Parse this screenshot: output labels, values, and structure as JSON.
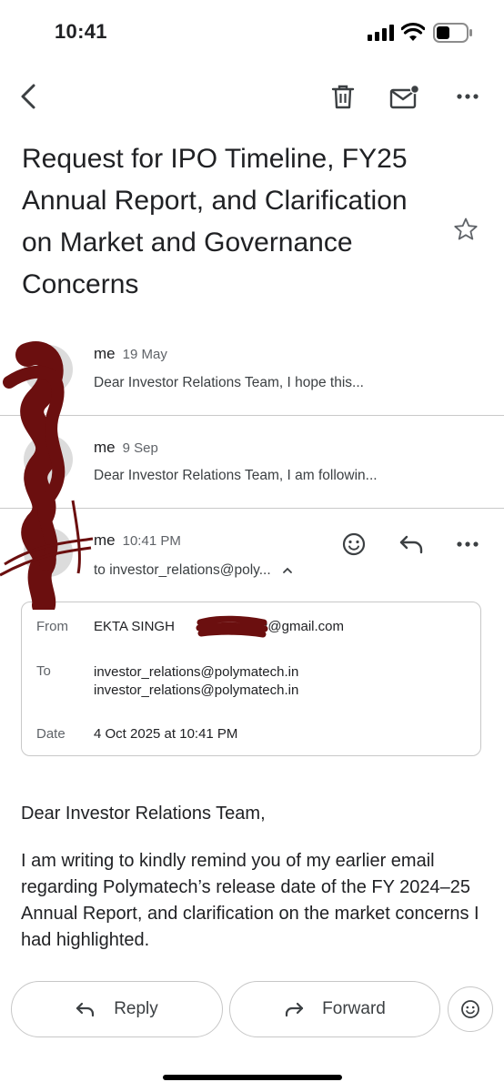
{
  "status_bar": {
    "time": "10:41"
  },
  "toolbar": {
    "back_icon": "chevron-left-icon",
    "delete_icon": "trash-icon",
    "mark_unread_icon": "mail-unread-icon",
    "more_icon": "more-horizontal-icon"
  },
  "email": {
    "subject": "Request for IPO Timeline, FY25 Annual Report, and Clarification on Market and Governance Concerns"
  },
  "thread": [
    {
      "sender": "me",
      "date": "19 May",
      "snippet": "Dear Investor Relations Team, I hope this..."
    },
    {
      "sender": "me",
      "date": "9 Sep",
      "snippet": "Dear Investor Relations Team, I am followin..."
    }
  ],
  "current_message": {
    "sender": "me",
    "time": "10:41 PM",
    "to_summary": "to investor_relations@poly...",
    "details": {
      "from_label": "From",
      "from_name": "EKTA SINGH",
      "from_email": "2@gmail.com",
      "to_label": "To",
      "to_values": [
        "investor_relations@polymatech.in",
        "investor_relations@polymatech.in"
      ],
      "date_label": "Date",
      "date_value": "4 Oct 2025 at 10:41 PM"
    },
    "body": [
      "Dear Investor Relations Team,",
      "I am writing to kindly remind you of my earlier email regarding Polymatech’s release date of the FY 2024–25 Annual Report, and clarification on the market concerns I had highlighted."
    ]
  },
  "actions": {
    "reply_label": "Reply",
    "forward_label": "Forward"
  },
  "colors": {
    "redaction": "#6b0f0f",
    "text": "#202124",
    "secondary": "#5f6368"
  }
}
